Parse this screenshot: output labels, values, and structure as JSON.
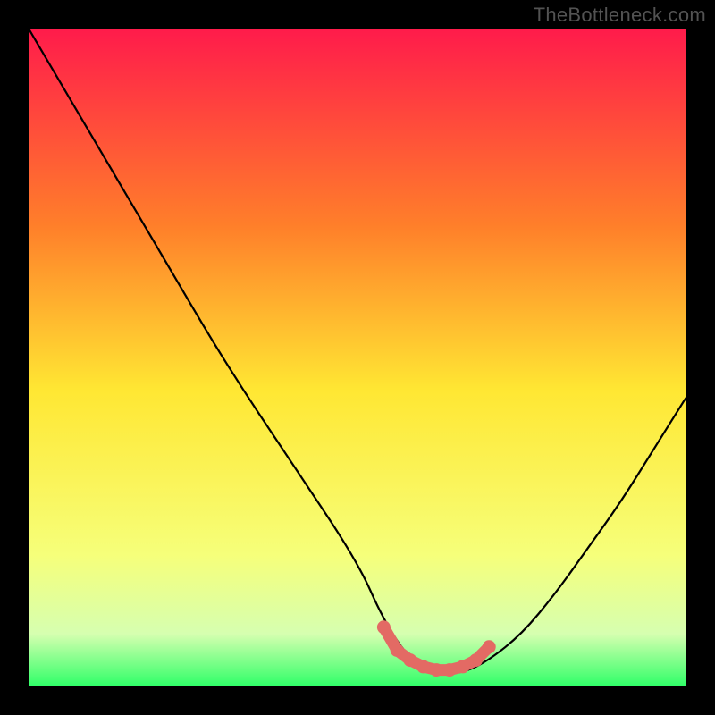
{
  "watermark": "TheBottleneck.com",
  "colors": {
    "background": "#000000",
    "gradient_top": "#ff1b4b",
    "gradient_mid_upper": "#ff7f2a",
    "gradient_mid": "#ffe733",
    "gradient_mid_lower": "#f6ff7a",
    "gradient_lower": "#d6ffb0",
    "gradient_bottom": "#2fff68",
    "curve": "#000000",
    "marker": "#e36a64"
  },
  "chart_data": {
    "type": "line",
    "title": "",
    "xlabel": "",
    "ylabel": "",
    "xlim": [
      0,
      100
    ],
    "ylim": [
      0,
      100
    ],
    "series": [
      {
        "name": "bottleneck-curve",
        "x": [
          0,
          10,
          20,
          30,
          40,
          50,
          54,
          58,
          62,
          66,
          70,
          75,
          80,
          85,
          90,
          95,
          100
        ],
        "y": [
          100,
          83,
          66,
          49,
          34,
          19,
          10,
          4,
          2,
          2,
          4,
          8,
          14,
          21,
          28,
          36,
          44
        ]
      }
    ],
    "markers": {
      "name": "optimal-range",
      "x": [
        54,
        56,
        58,
        60,
        62,
        64,
        66,
        68,
        70
      ],
      "y": [
        9.0,
        5.5,
        4.0,
        3.0,
        2.5,
        2.5,
        3.0,
        4.0,
        6.0
      ]
    }
  }
}
